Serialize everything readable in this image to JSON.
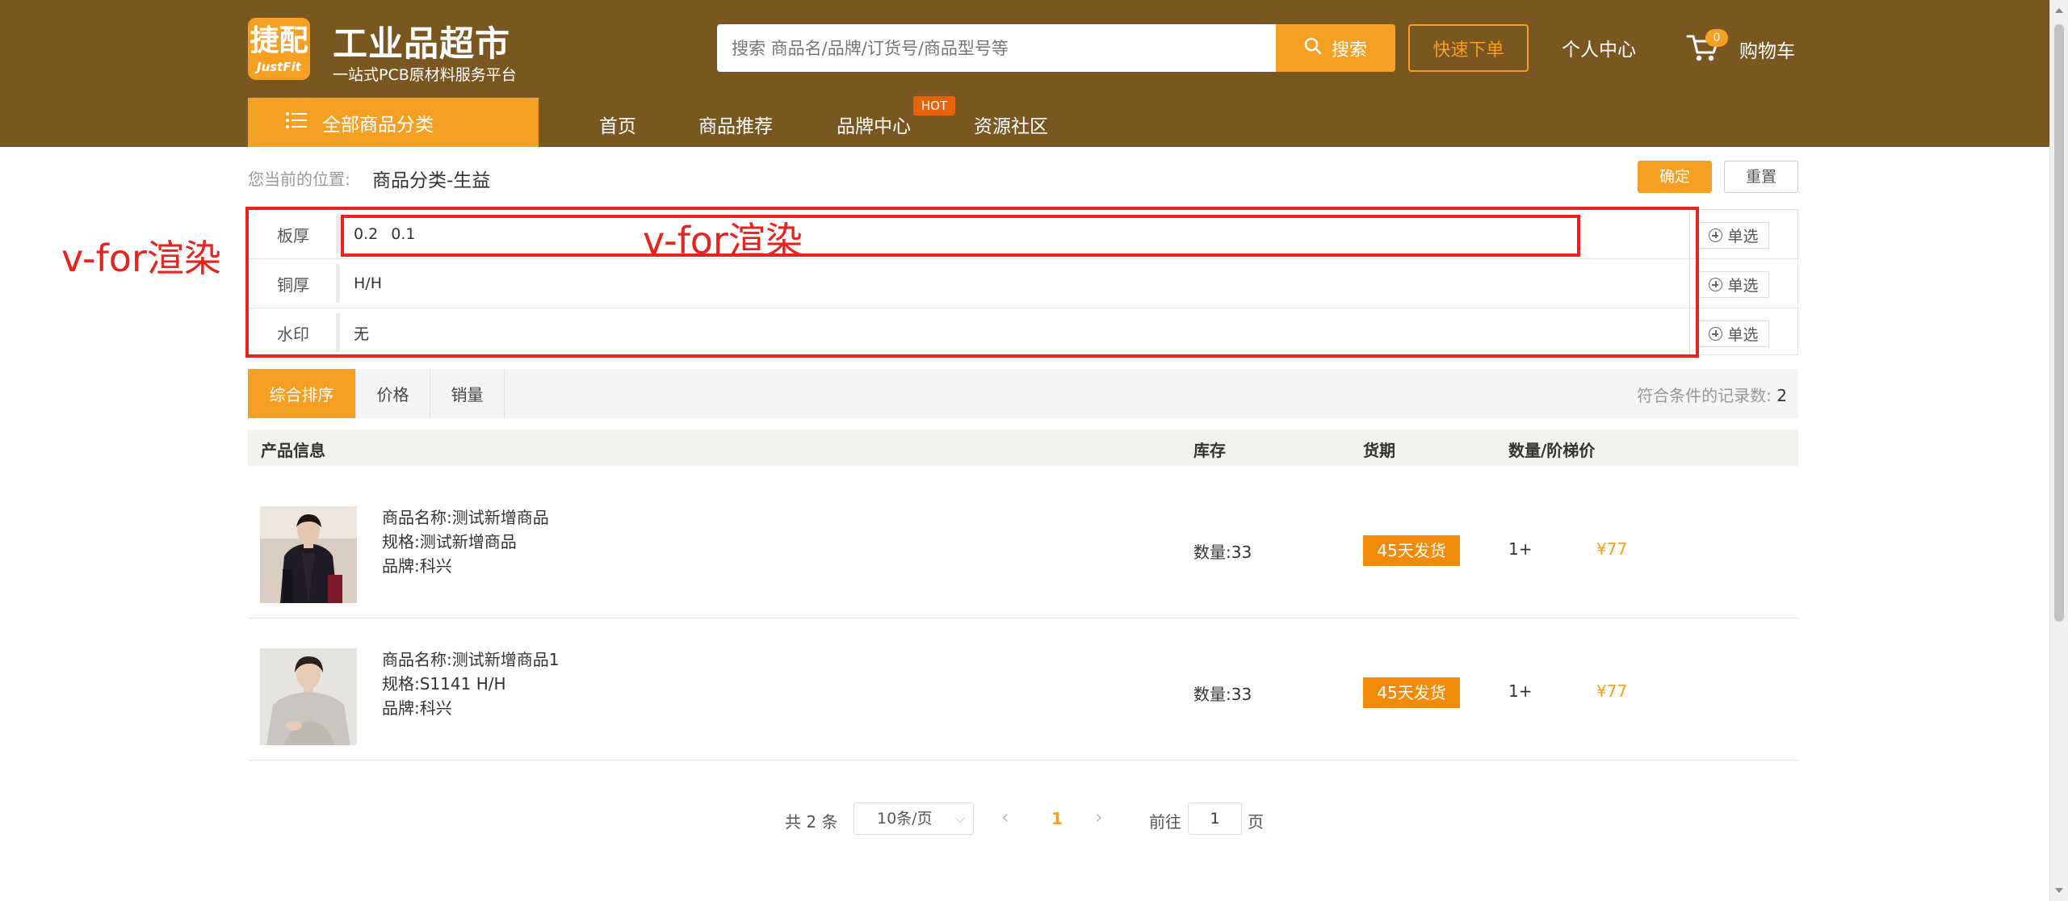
{
  "header": {
    "logo_char": "捷配",
    "logo_en": "JustFit",
    "site_title": "工业品超市",
    "site_subtitle": "一站式PCB原材料服务平台",
    "search_placeholder": "搜索 商品名/品牌/订货号/商品型号等",
    "search_button": "搜索",
    "quick_order": "快速下单",
    "user_center": "个人中心",
    "cart_count": "0",
    "cart_label": "购物车"
  },
  "nav": {
    "category_button": "全部商品分类",
    "items": [
      "首页",
      "商品推荐",
      "品牌中心",
      "资源社区"
    ],
    "hot_badge": "HOT"
  },
  "breadcrumb": {
    "label": "您当前的位置:",
    "value": "商品分类-生益"
  },
  "actions": {
    "confirm": "确定",
    "reset": "重置"
  },
  "filters": [
    {
      "key": "板厚",
      "values": [
        "0.2",
        "0.1"
      ],
      "button": "单选"
    },
    {
      "key": "铜厚",
      "values": [
        "H/H"
      ],
      "button": "单选"
    },
    {
      "key": "水印",
      "values": [
        "无"
      ],
      "button": "单选"
    }
  ],
  "annotations": {
    "left": "v-for渲染",
    "middle": "v-for渲染",
    "color": "#e8221c"
  },
  "sort": {
    "tabs": [
      "综合排序",
      "价格",
      "销量"
    ],
    "active_index": 0,
    "record_label": "符合条件的记录数:",
    "record_count": "2"
  },
  "table": {
    "headers": [
      "产品信息",
      "库存",
      "货期",
      "数量/阶梯价"
    ],
    "rows": [
      {
        "name": "商品名称:测试新增商品",
        "spec": "规格:测试新增商品",
        "brand": "品牌:科兴",
        "stock": "数量:33",
        "lead_time": "45天发货",
        "qty": "1+",
        "price": "¥77"
      },
      {
        "name": "商品名称:测试新增商品1",
        "spec": "规格:S1141 H/H",
        "brand": "品牌:科兴",
        "stock": "数量:33",
        "lead_time": "45天发货",
        "qty": "1+",
        "price": "¥77"
      }
    ]
  },
  "pagination": {
    "total": "共 2 条",
    "page_size": "10条/页",
    "current_page": "1",
    "goto_label": "前往",
    "goto_value": "1",
    "page_suffix": "页"
  },
  "colors": {
    "brand_brown": "#7a5720",
    "accent_orange": "#f5a023",
    "annotation_red": "#e8221c"
  }
}
